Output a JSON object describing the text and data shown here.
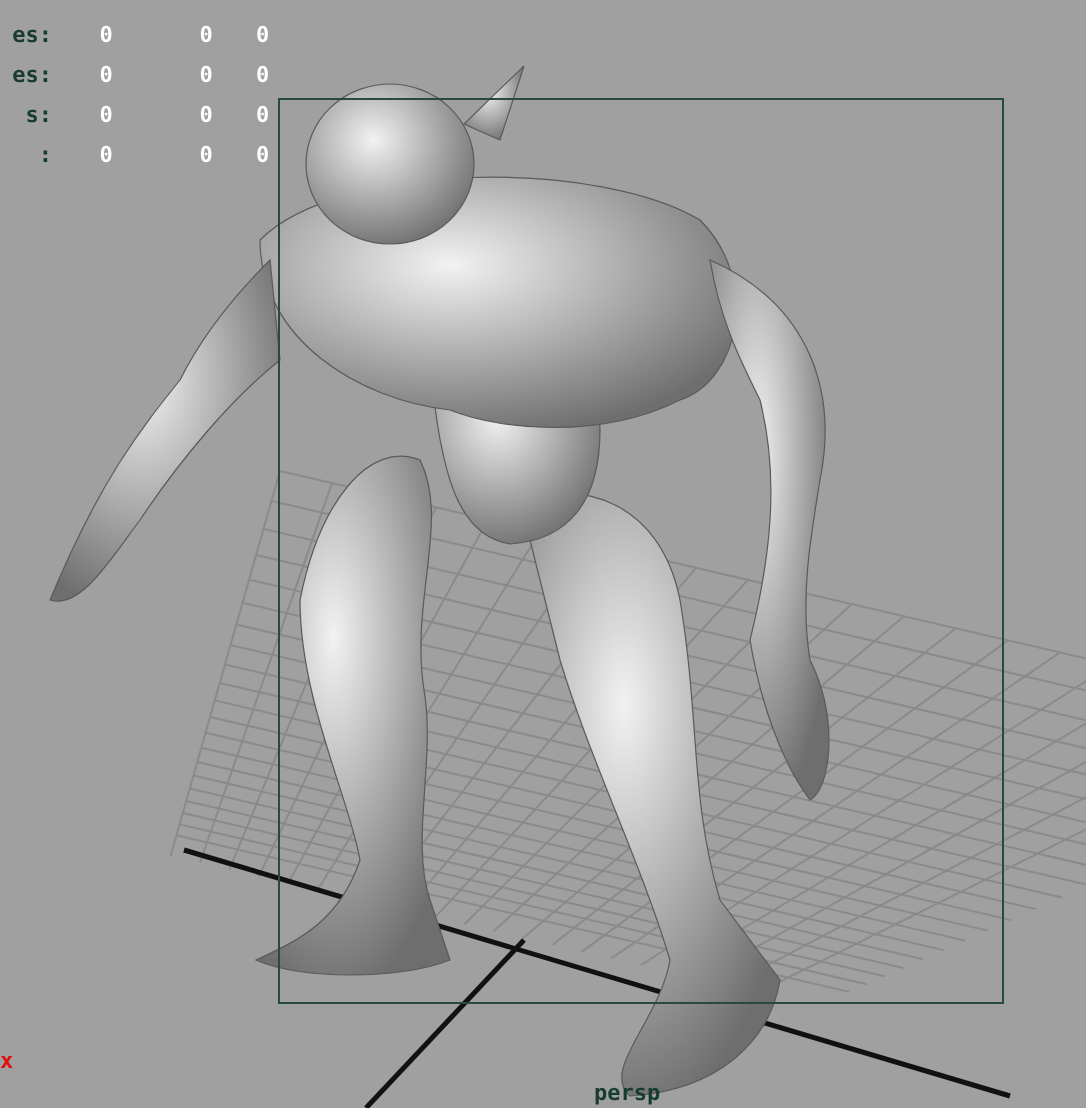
{
  "hud": {
    "rows": [
      {
        "label": "es:",
        "values": [
          "0",
          "0",
          "0"
        ]
      },
      {
        "label": "es:",
        "values": [
          "0",
          "0",
          "0"
        ]
      },
      {
        "label": "s:",
        "values": [
          "0",
          "0",
          "0"
        ]
      },
      {
        "label": ":",
        "values": [
          "0",
          "0",
          "0"
        ]
      }
    ]
  },
  "axis_label": "x",
  "camera_label": "persp"
}
